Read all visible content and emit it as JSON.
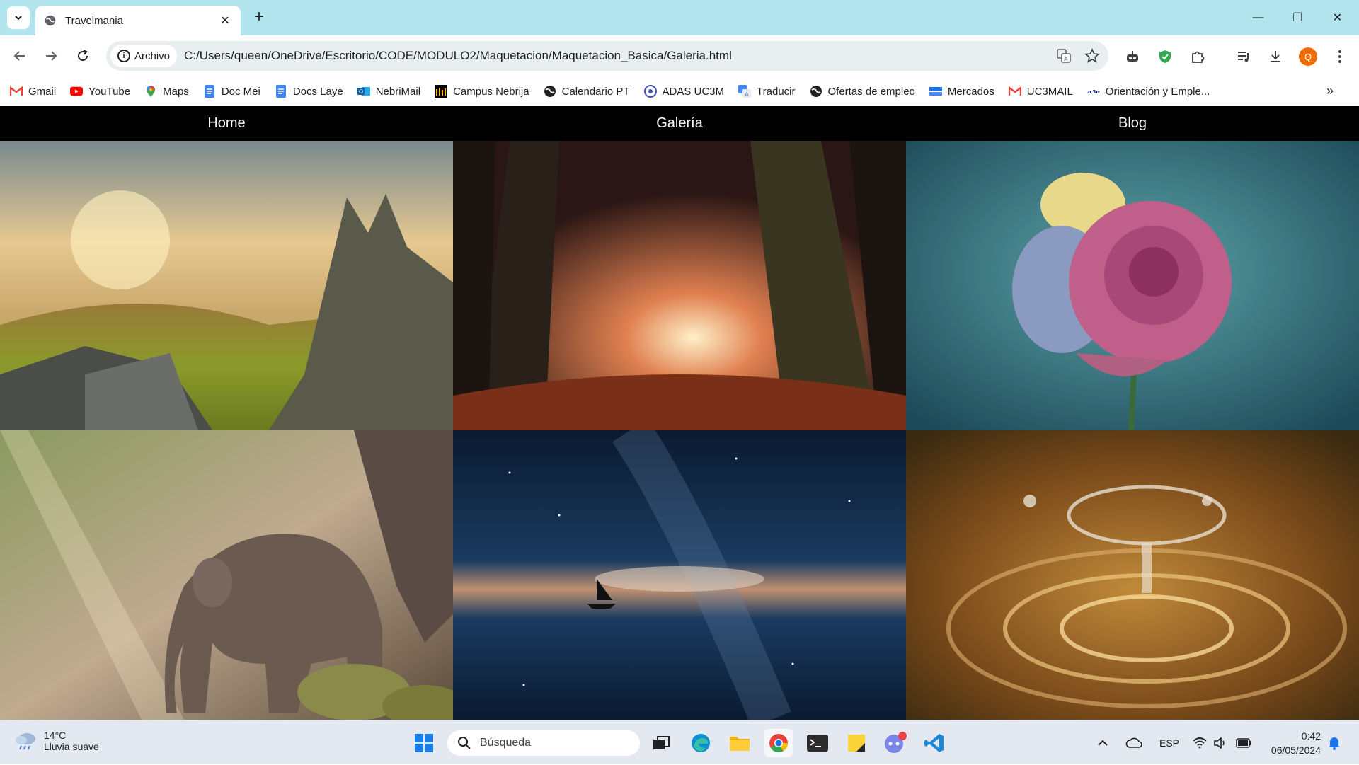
{
  "browser": {
    "tab_title": "Travelmania",
    "security_chip": "Archivo",
    "url": "C:/Users/queen/OneDrive/Escritorio/CODE/MODULO2/Maquetacion/Maquetacion_Basica/Galeria.html",
    "profile_initial": "Q"
  },
  "bookmarks": [
    {
      "label": "Gmail",
      "icon": "gmail-icon"
    },
    {
      "label": "YouTube",
      "icon": "youtube-icon"
    },
    {
      "label": "Maps",
      "icon": "maps-icon"
    },
    {
      "label": "Doc Mei",
      "icon": "docs-icon"
    },
    {
      "label": "Docs Laye",
      "icon": "docs-icon"
    },
    {
      "label": "NebriMail",
      "icon": "outlook-icon"
    },
    {
      "label": "Campus Nebrija",
      "icon": "campus-icon"
    },
    {
      "label": "Calendario PT",
      "icon": "globe-icon"
    },
    {
      "label": "ADAS UC3M",
      "icon": "adas-icon"
    },
    {
      "label": "Traducir",
      "icon": "translate-icon"
    },
    {
      "label": "Ofertas de empleo",
      "icon": "globe-icon"
    },
    {
      "label": "Mercados",
      "icon": "mercados-icon"
    },
    {
      "label": "UC3MAIL",
      "icon": "gmail-icon"
    },
    {
      "label": "Orientación y Emple...",
      "icon": "uc3m-icon"
    }
  ],
  "page": {
    "nav": [
      "Home",
      "Galería",
      "Blog"
    ],
    "gallery": [
      "mountain-landscape",
      "autumn-forest",
      "rose-flower",
      "elephant",
      "sailboat-night-sky",
      "water-drop-splash"
    ]
  },
  "taskbar": {
    "temperature": "14°C",
    "weather": "Lluvia suave",
    "search_placeholder": "Búsqueda",
    "language": "ESP",
    "time": "0:42",
    "date": "06/05/2024"
  }
}
